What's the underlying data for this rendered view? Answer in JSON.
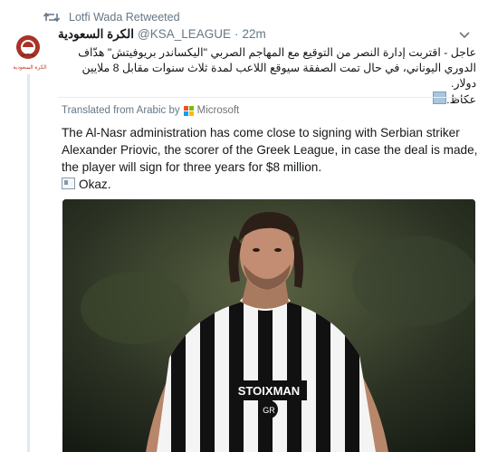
{
  "retweet": {
    "retweeted_by": "Lotfi Wada Retweeted"
  },
  "tweet": {
    "display_name": "الكرة السعودية",
    "handle": "@KSA_LEAGUE",
    "separator": "·",
    "time": "22m",
    "avatar_caption": "الكرة السعودية",
    "text_arabic": "عاجل - اقتربت إدارة النصر من التوقيع مع المهاجم الصربي \"اليكساندر بريوفيتش\" هدّاف الدوري اليوناني، في حال تمت الصفقة سيوقع اللاعب لمدة ثلاث سنوات مقابل 8 ملايين دولار.",
    "source_arabic": "عكاظ."
  },
  "translation": {
    "label": "Translated from Arabic by",
    "provider": "Microsoft",
    "text": "The Al-Nasr administration has come close to signing with Serbian striker Alexander Priovic, the scorer of the Greek League, in case the deal is made, the player will sign for three years for $8 million.",
    "source": "Okaz."
  },
  "photo": {
    "shirt_sponsor": "STOIXMAN",
    "shirt_badge": "GR"
  },
  "colors": {
    "secondary_text": "#657786",
    "ms_red": "#f25022",
    "ms_green": "#7fba00",
    "ms_blue": "#00a4ef",
    "ms_yellow": "#ffb900"
  },
  "icons": [
    "retweet-icon",
    "caret-down-icon",
    "newspaper-icon",
    "microsoft-logo-icon"
  ]
}
